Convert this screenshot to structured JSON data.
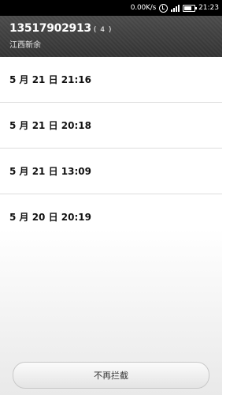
{
  "status_bar": {
    "net_speed": "0.00K/s",
    "time": "21:23"
  },
  "header": {
    "phone_number": "13517902913",
    "count": "( 4 )",
    "location": "江西新余"
  },
  "calls": [
    {
      "datetime": "5 月 21 日 21:16"
    },
    {
      "datetime": "5 月 21 日 20:18"
    },
    {
      "datetime": "5 月 21 日 13:09"
    },
    {
      "datetime": "5 月 20 日 20:19"
    }
  ],
  "actions": {
    "unblock_label": "不再拦截"
  }
}
